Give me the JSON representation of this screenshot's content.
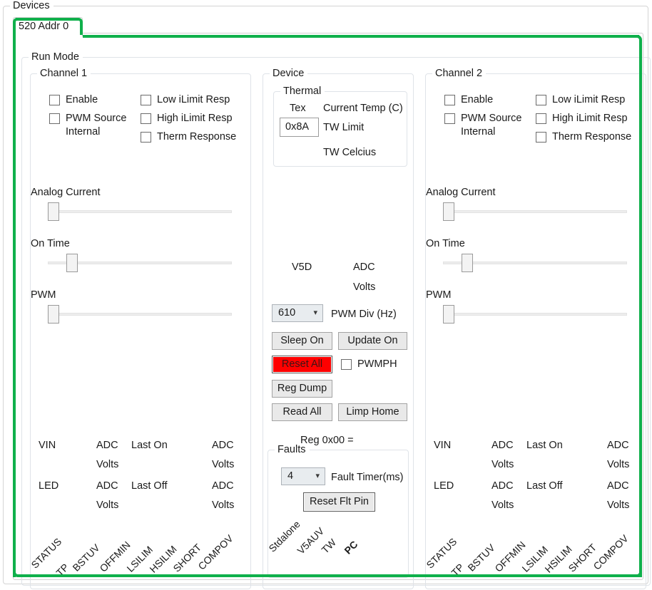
{
  "window": {
    "devices_group_title": "Devices"
  },
  "tabs": [
    {
      "label": "520 Addr 0",
      "selected": true
    }
  ],
  "run_mode": {
    "title": "Run Mode"
  },
  "channel1": {
    "title": "Channel 1",
    "checkboxes": [
      {
        "label": "Enable",
        "label2": "",
        "checked": false
      },
      {
        "label": "PWM Source",
        "label2": "Internal",
        "checked": false
      },
      {
        "label": "Low iLimit Resp",
        "label2": "",
        "checked": false
      },
      {
        "label": "High iLimit Resp",
        "label2": "",
        "checked": false
      },
      {
        "label": "Therm Response",
        "label2": "",
        "checked": false
      }
    ],
    "sliders": [
      {
        "label": "Analog Current",
        "percent": 0
      },
      {
        "label": "On Time",
        "percent": 10
      },
      {
        "label": "PWM",
        "percent": 0
      }
    ],
    "readouts": {
      "vin_label": "VIN",
      "vin_adc": "ADC",
      "vin_volts": "Volts",
      "last_on_label": "Last On",
      "last_on_adc": "ADC",
      "last_on_volts": "Volts",
      "led_label": "LED",
      "led_adc": "ADC",
      "led_volts": "Volts",
      "last_off_label": "Last Off",
      "last_off_adc": "ADC",
      "last_off_volts": "Volts"
    },
    "status_flags": [
      "STATUS",
      "TP",
      "BSTUV",
      "OFFMIN",
      "LSILIM",
      "HSILIM",
      "SHORT",
      "COMPOV"
    ]
  },
  "channel2": {
    "title": "Channel 2",
    "checkboxes": [
      {
        "label": "Enable",
        "label2": "",
        "checked": false
      },
      {
        "label": "PWM Source",
        "label2": "Internal",
        "checked": false
      },
      {
        "label": "Low iLimit Resp",
        "label2": "",
        "checked": false
      },
      {
        "label": "High iLimit Resp",
        "label2": "",
        "checked": false
      },
      {
        "label": "Therm Response",
        "label2": "",
        "checked": false
      }
    ],
    "sliders": [
      {
        "label": "Analog Current",
        "percent": 0
      },
      {
        "label": "On Time",
        "percent": 10
      },
      {
        "label": "PWM",
        "percent": 0
      }
    ],
    "readouts": {
      "vin_label": "VIN",
      "vin_adc": "ADC",
      "vin_volts": "Volts",
      "last_on_label": "Last On",
      "last_on_adc": "ADC",
      "last_on_volts": "Volts",
      "led_label": "LED",
      "led_adc": "ADC",
      "led_volts": "Volts",
      "last_off_label": "Last Off",
      "last_off_adc": "ADC",
      "last_off_volts": "Volts"
    },
    "status_flags": [
      "STATUS",
      "TP",
      "BSTUV",
      "OFFMIN",
      "LSILIM",
      "HSILIM",
      "SHORT",
      "COMPOV"
    ]
  },
  "device": {
    "title": "Device",
    "thermal": {
      "title": "Thermal",
      "tex_label": "Tex",
      "current_temp_label": "Current Temp (C)",
      "tw_limit_value": "0x8A",
      "tw_limit_label": "TW Limit",
      "tw_celcius_label": "TW Celcius"
    },
    "v5d_label": "V5D",
    "v5d_adc": "ADC",
    "v5d_volts": "Volts",
    "pwm_div": {
      "value": "610",
      "label": "PWM Div (Hz)",
      "arrow": "chevron-down-icon"
    },
    "buttons": {
      "sleep": "Sleep On",
      "update": "Update On",
      "reset_all": "Reset All",
      "reg_dump": "Reg Dump",
      "read_all": "Read All",
      "limp_home": "Limp Home"
    },
    "pwmph_checkbox": {
      "label": "PWMPH",
      "checked": false
    },
    "reg_readout": "Reg 0x00 =",
    "faults": {
      "title": "Faults",
      "timer_value": "4",
      "timer_label": "Fault Timer(ms)",
      "reset_button": "Reset Flt Pin",
      "flags": [
        {
          "label": "Stdalone",
          "bold": false
        },
        {
          "label": "V5AUV",
          "bold": false
        },
        {
          "label": "TW",
          "bold": false
        },
        {
          "label": "PC",
          "bold": true
        }
      ]
    }
  },
  "colors": {
    "selection_green": "#0fb04b",
    "reset_all_red": "#ff0000",
    "border_gray": "#dfe3e8",
    "text": "#1a1a1a"
  }
}
